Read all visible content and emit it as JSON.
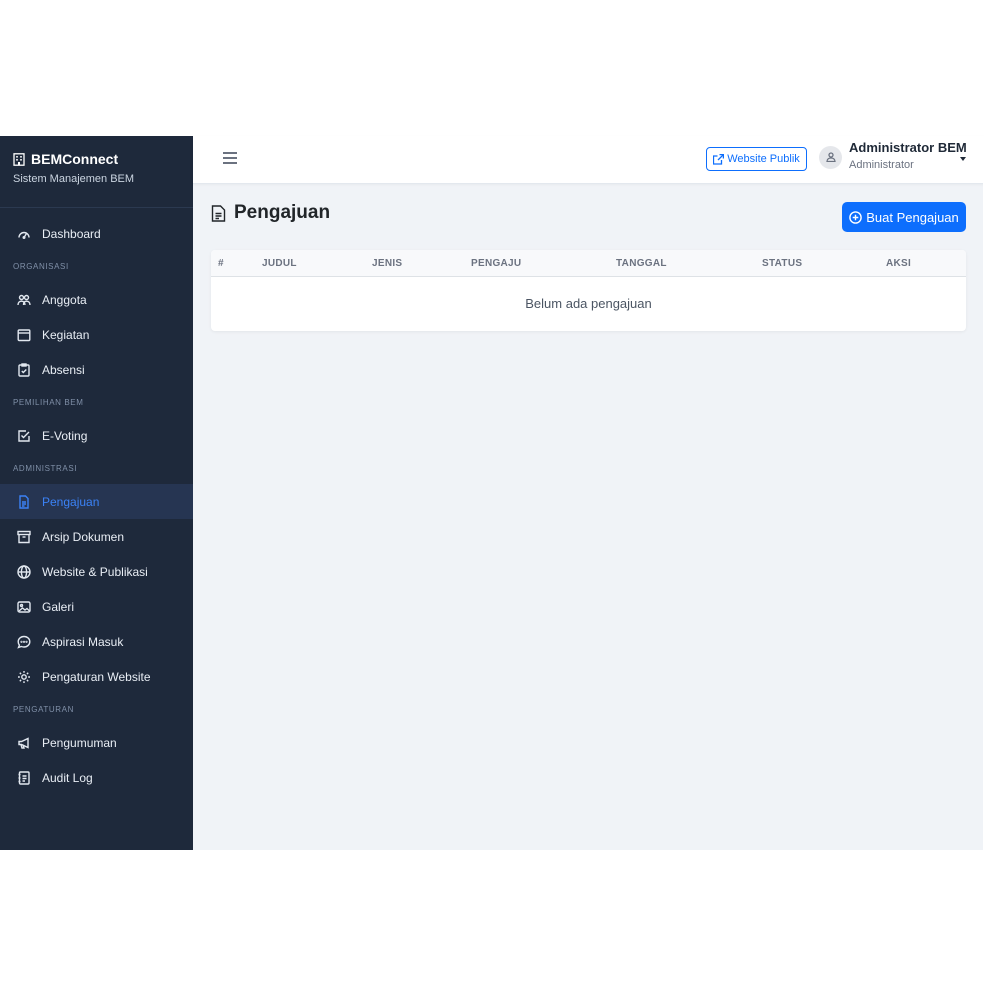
{
  "brand": {
    "title": "BEMConnect",
    "subtitle": "Sistem Manajemen BEM"
  },
  "sidebar": {
    "dashboard": "Dashboard",
    "section_organisasi": "ORGANISASI",
    "anggota": "Anggota",
    "kegiatan": "Kegiatan",
    "absensi": "Absensi",
    "section_pemilihan": "PEMILIHAN BEM",
    "evoting": "E-Voting",
    "section_administrasi": "ADMINISTRASI",
    "pengajuan": "Pengajuan",
    "arsip": "Arsip Dokumen",
    "website": "Website & Publikasi",
    "galeri": "Galeri",
    "aspirasi": "Aspirasi Masuk",
    "pengaturan_website": "Pengaturan Website",
    "section_pengaturan": "PENGATURAN",
    "pengumuman": "Pengumuman",
    "audit": "Audit Log",
    "active_item": "Pengajuan"
  },
  "topbar": {
    "public_button": "Website Publik",
    "user_name": "Administrator BEM",
    "user_role": "Administrator"
  },
  "page": {
    "title": "Pengajuan",
    "create_button": "Buat Pengajuan"
  },
  "table": {
    "columns": [
      "#",
      "JUDUL",
      "JENIS",
      "PENGAJU",
      "TANGGAL",
      "STATUS",
      "AKSI"
    ],
    "rows": [],
    "empty_message": "Belum ada pengajuan"
  },
  "colors": {
    "sidebar_bg": "#1e293b",
    "accent": "#0d6efd",
    "active_text": "#3b82f6",
    "main_bg": "#f0f3f7"
  }
}
